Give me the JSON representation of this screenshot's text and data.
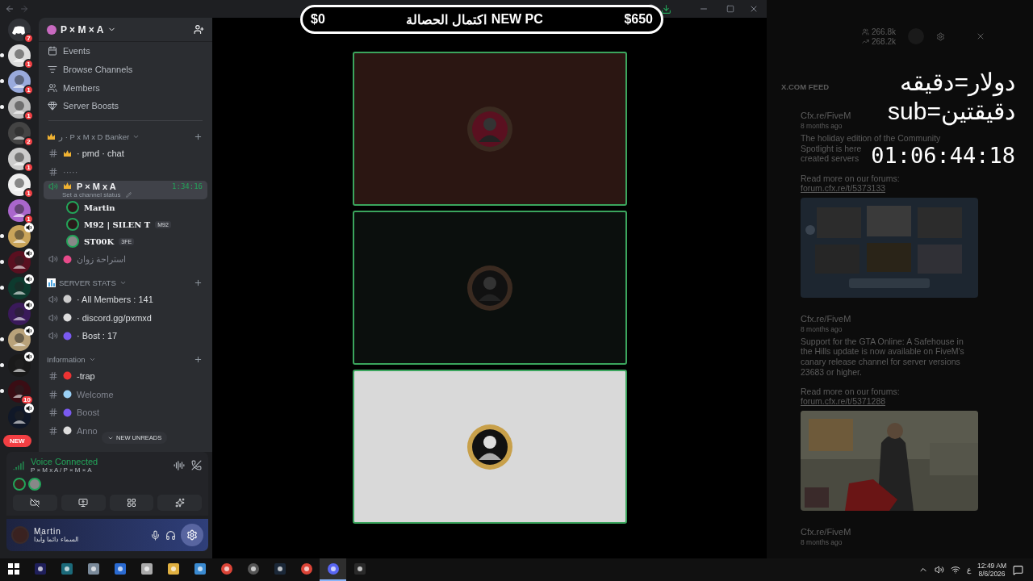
{
  "server_rail": [
    {
      "kind": "home",
      "badge": "7",
      "unread": false,
      "voice_active": false
    },
    {
      "kind": "server",
      "badge": "1",
      "unread": true,
      "voice_active": false
    },
    {
      "kind": "server",
      "badge": "1",
      "unread": true,
      "voice_active": false
    },
    {
      "kind": "server",
      "badge": "1",
      "unread": true,
      "voice_active": false
    },
    {
      "kind": "server",
      "badge": "2",
      "unread": false,
      "voice_active": false
    },
    {
      "kind": "server",
      "badge": "1",
      "unread": false,
      "voice_active": false
    },
    {
      "kind": "server",
      "badge": "1",
      "unread": false,
      "voice_active": false
    },
    {
      "kind": "server",
      "badge": "1",
      "unread": false,
      "voice_active": false
    },
    {
      "kind": "server",
      "unread": true,
      "voice_active": true
    },
    {
      "kind": "server",
      "unread": true,
      "voice_active": true
    },
    {
      "kind": "server",
      "unread": true,
      "voice_active": true
    },
    {
      "kind": "server",
      "unread": false,
      "voice_active": true
    },
    {
      "kind": "server",
      "unread": true,
      "voice_active": true
    },
    {
      "kind": "server",
      "unread": true,
      "voice_active": true
    },
    {
      "kind": "server",
      "badge": "10",
      "unread": true,
      "voice_active": false
    },
    {
      "kind": "server",
      "unread": false,
      "voice_active": true
    }
  ],
  "rail_new_pill": "NEW",
  "server": {
    "name": "P × M × A"
  },
  "nav": [
    {
      "kind": "events",
      "label": "Events"
    },
    {
      "kind": "browse",
      "label": "Browse Channels"
    },
    {
      "kind": "members",
      "label": "Members"
    },
    {
      "kind": "boosts",
      "label": "Server Boosts"
    }
  ],
  "categories": [
    {
      "name": "ر · P x M x D Banker",
      "channels": [
        {
          "kind": "text",
          "name": "· pmd · chat",
          "selected": false,
          "unread": true
        },
        {
          "kind": "text",
          "name": "·····",
          "selected": false,
          "unread": false
        },
        {
          "kind": "voice",
          "name": "P × M x A",
          "selected": true,
          "unread": true,
          "timer": "1:34:16",
          "status": "Set a channel status",
          "members": [
            {
              "name": "Martin"
            },
            {
              "name": "M92 | SILEN T",
              "tag": "M92"
            },
            {
              "name": "ST00K",
              "tag": "3FE"
            }
          ]
        },
        {
          "kind": "voice",
          "name": "استراحة زوان",
          "selected": false,
          "unread": false
        }
      ]
    },
    {
      "name": "SERVER STATS",
      "channels": [
        {
          "kind": "voice",
          "name": "· All Members : 141",
          "selected": false,
          "unread": true
        },
        {
          "kind": "voice",
          "name": "· discord.gg/pxmxd",
          "selected": false,
          "unread": true
        },
        {
          "kind": "voice",
          "name": "· Bost : 17",
          "selected": false,
          "unread": true
        }
      ]
    },
    {
      "name": "Information",
      "channels": [
        {
          "kind": "text",
          "name": "-trap",
          "selected": false,
          "unread": true
        },
        {
          "kind": "text",
          "name": "Welcome",
          "selected": false,
          "unread": false
        },
        {
          "kind": "text",
          "name": "Boost",
          "selected": false,
          "unread": false
        },
        {
          "kind": "text",
          "name": "Anno",
          "selected": false,
          "unread": false
        }
      ]
    }
  ],
  "new_unreads": "NEW UNREADS",
  "voice_panel": {
    "title": "Voice Connected",
    "channel": "P × M x A / P × M × A"
  },
  "user_panel": {
    "name": "Martin",
    "status": "السماء دائما وأبدا"
  },
  "goal_overlay": {
    "start": "$0",
    "caption": "اكتمال الحصالة",
    "title": "NEW PC",
    "target": "$650"
  },
  "video_tiles": [
    {
      "color": "#2b1612",
      "speaking": true
    },
    {
      "color": "#0b0f0d",
      "speaking": true
    },
    {
      "color": "#d9d9d9",
      "speaking": true
    }
  ],
  "feed_panel": {
    "stats": [
      {
        "kind": "followers",
        "value": "266.8k"
      },
      {
        "kind": "growth",
        "value": "268.2k"
      }
    ],
    "title": "X.COM FEED",
    "posts": [
      {
        "author": "Cfx.re/FiveM",
        "time": "8 months ago",
        "lines": [
          "The holiday edition of the Community",
          "Spotlight is here",
          "created servers"
        ],
        "read_more": "Read more on our forums:",
        "link": "forum.cfx.re/t/5373133",
        "media": {
          "kind": "picture"
        }
      },
      {
        "author": "Cfx.re/FiveM",
        "time": "8 months ago",
        "lines": [
          "Support for the GTA Online: A Safehouse in",
          "the Hills update is now available on FiveM's",
          "canary release channel for server versions",
          "23683 or higher."
        ],
        "read_more": "Read more on our forums:",
        "link": "forum.cfx.re/t/5371288",
        "media": {
          "kind": "picture"
        }
      },
      {
        "author": "Cfx.re/FiveM",
        "time": "8 months ago"
      }
    ]
  },
  "stream_overlay": {
    "lines": [
      "دولار=دقيقه",
      "sub=دقيقتين"
    ],
    "timer": "01:06:44:18"
  },
  "taskbar": {
    "apps": [
      {
        "kind": "ae",
        "active": false
      },
      {
        "kind": "v",
        "active": false
      },
      {
        "kind": "calc",
        "active": false
      },
      {
        "kind": "window",
        "active": false
      },
      {
        "kind": "tool",
        "active": false
      },
      {
        "kind": "folder",
        "active": false
      },
      {
        "kind": "store",
        "active": false
      },
      {
        "kind": "chrome",
        "active": false
      },
      {
        "kind": "obs",
        "active": false
      },
      {
        "kind": "steam",
        "active": false
      },
      {
        "kind": "chrome",
        "active": false
      },
      {
        "kind": "discord",
        "active": true
      },
      {
        "kind": "terminal",
        "active": false
      }
    ],
    "ime": "ع",
    "time": "12:49 AM",
    "date": "8/6/2026"
  }
}
